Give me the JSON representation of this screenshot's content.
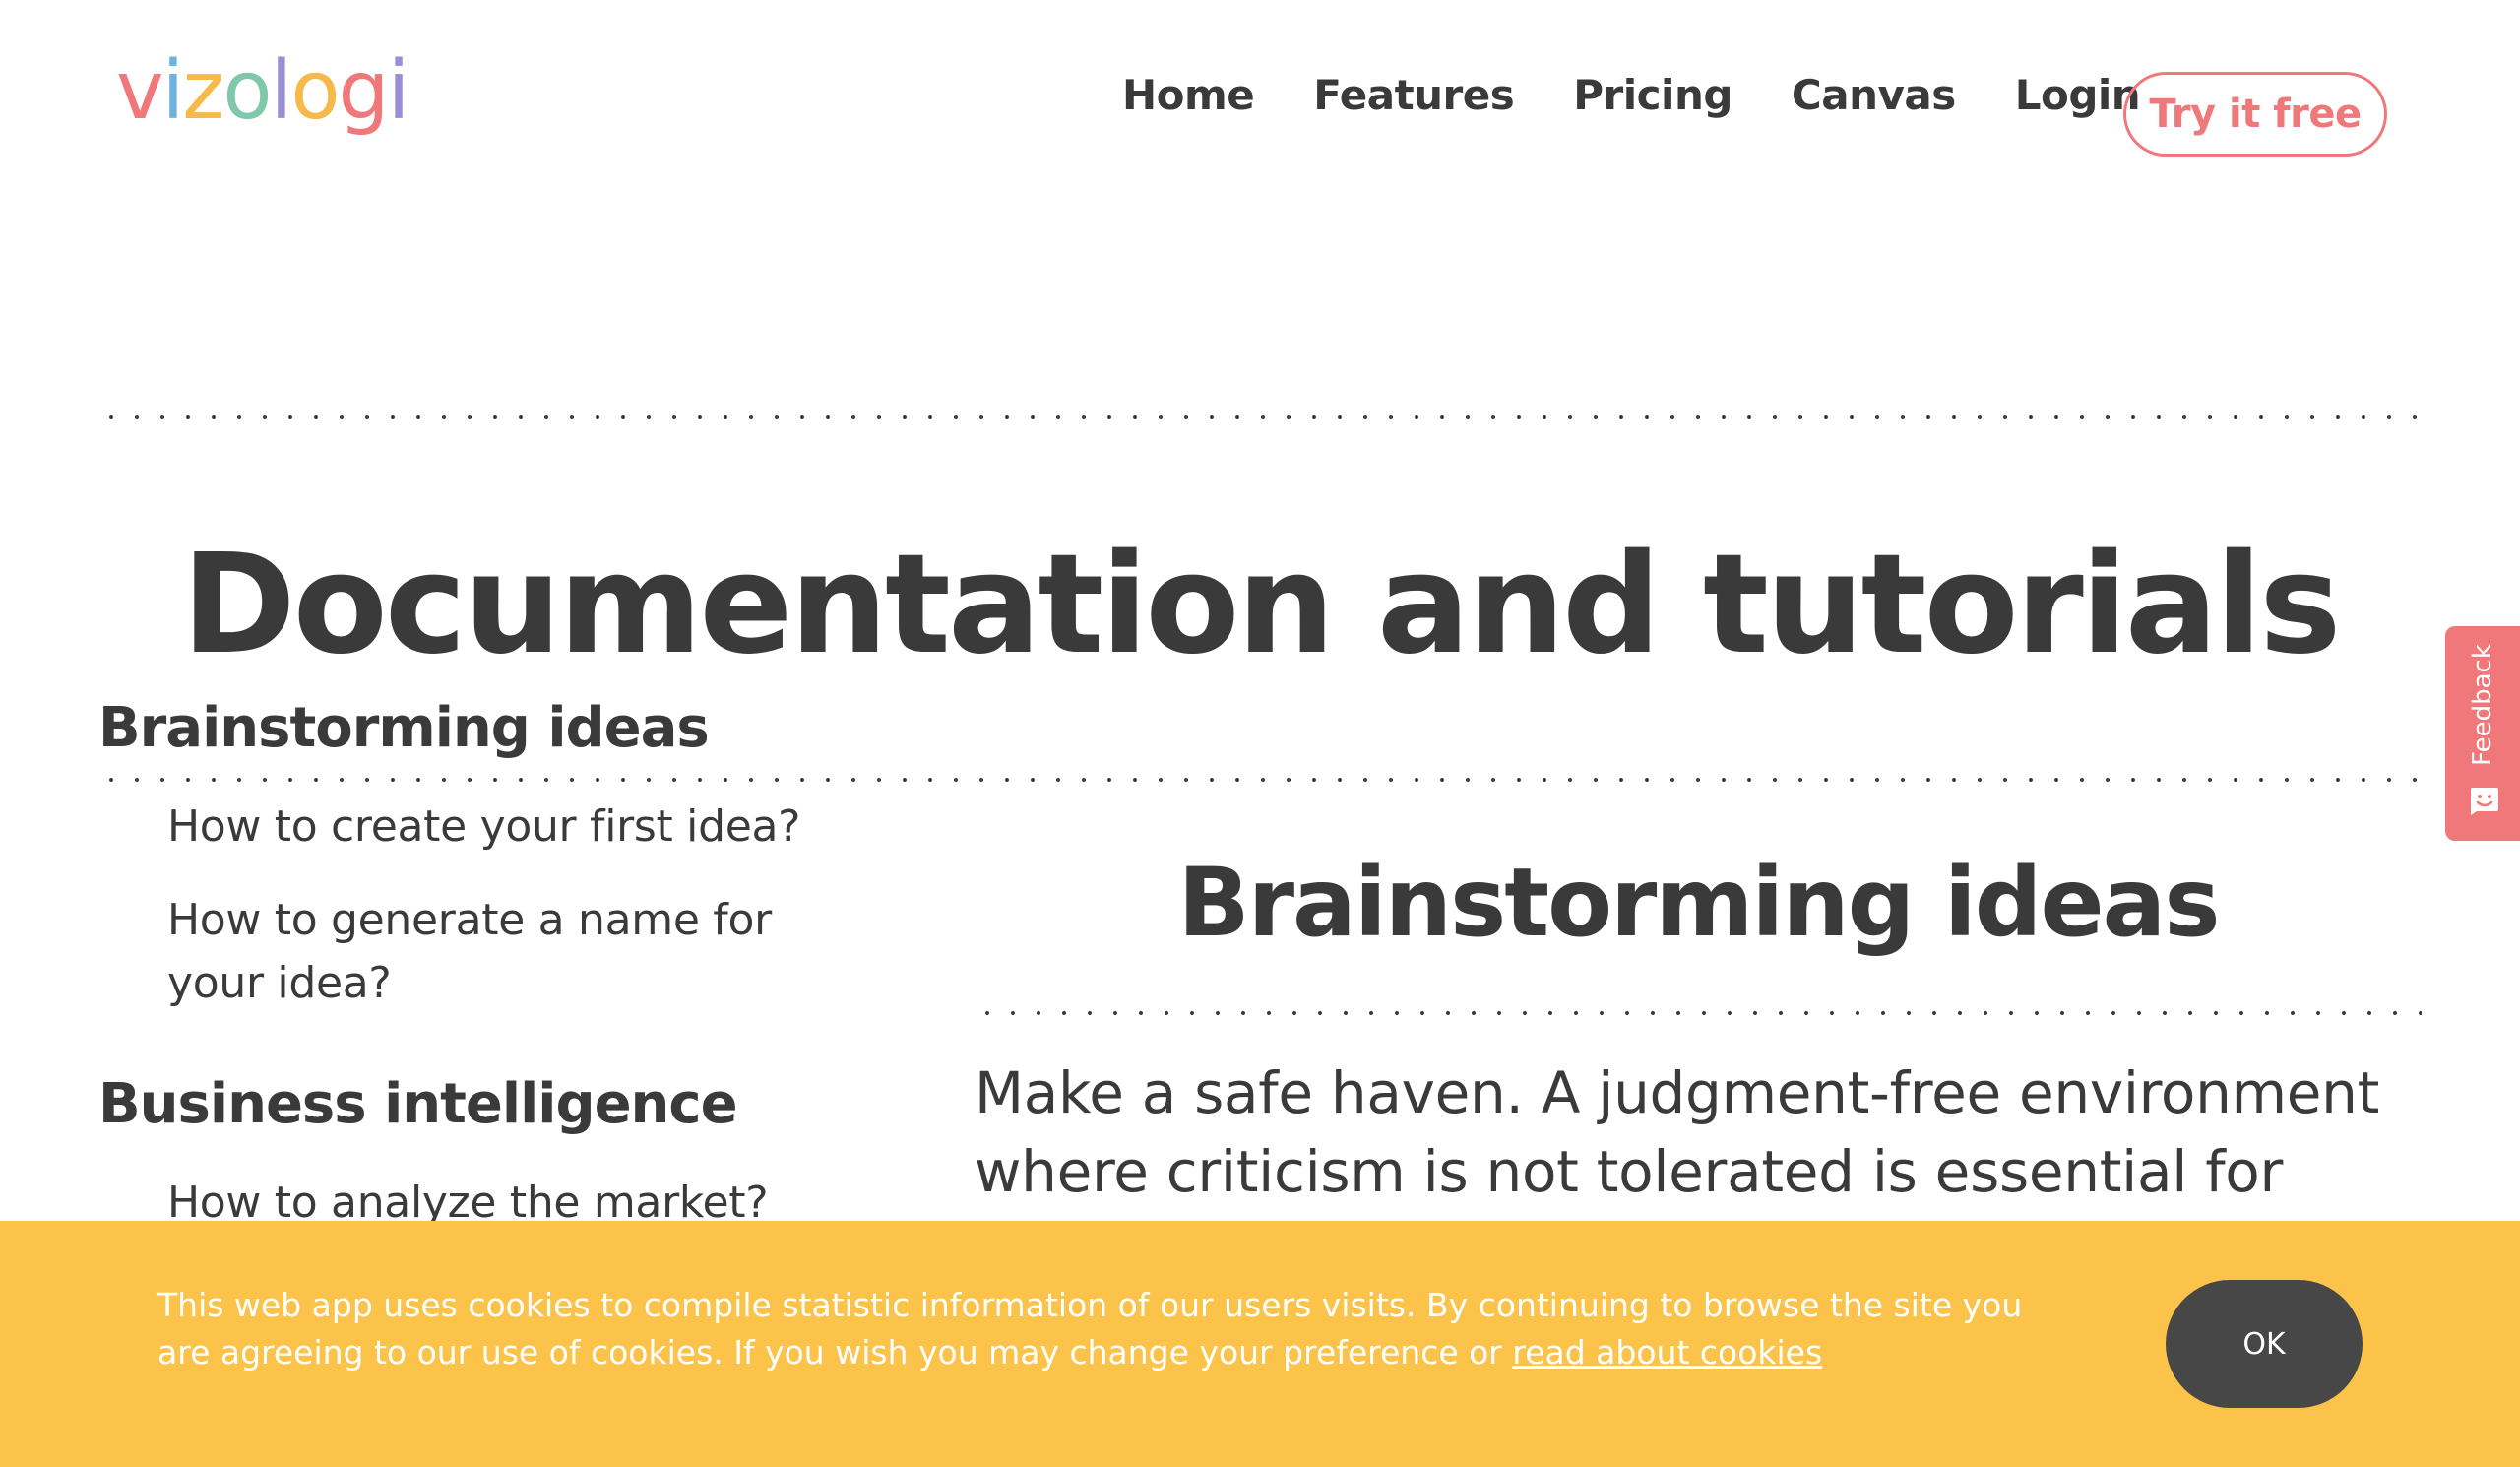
{
  "header": {
    "logo_letters": [
      {
        "char": "v",
        "color": "#f0777a"
      },
      {
        "char": "i",
        "color": "#6db3e0"
      },
      {
        "char": "z",
        "color": "#f7b94a"
      },
      {
        "char": "o",
        "color": "#7fc8a9"
      },
      {
        "char": "l",
        "color": "#9b8ed6"
      },
      {
        "char": "o",
        "color": "#f7b94a"
      },
      {
        "char": "g",
        "color": "#f0777a"
      },
      {
        "char": "i",
        "color": "#9b8ed6"
      }
    ],
    "nav": [
      "Home",
      "Features",
      "Pricing",
      "Canvas",
      "Login"
    ],
    "cta_label": "Try it free"
  },
  "main": {
    "page_title": "Documentation and tutorials",
    "sidebar": {
      "sections": [
        {
          "heading": "Brainstorming ideas",
          "items": [
            "How to create your first idea?",
            "How to generate a name for your idea?"
          ]
        },
        {
          "heading": "Business intelligence",
          "items": [
            "How to analyze the market?"
          ]
        }
      ]
    },
    "content": {
      "title": "Brainstorming ideas",
      "body": "Make a safe haven. A judgment-free environment where criticism is not tolerated is essential for"
    }
  },
  "feedback": {
    "label": "Feedback",
    "icon": "smiley-chat-icon"
  },
  "cookie_banner": {
    "text": "This web app uses cookies to compile statistic information of our users visits. By continuing to browse the site you are agreeing to our use of cookies. If you wish you may change your preference or ",
    "link_text": "read about cookies",
    "ok_label": "OK"
  },
  "colors": {
    "accent": "#f0777a",
    "text": "#3a3a3a",
    "cookie_bg": "#fcc34a",
    "ok_bg": "#474747"
  }
}
